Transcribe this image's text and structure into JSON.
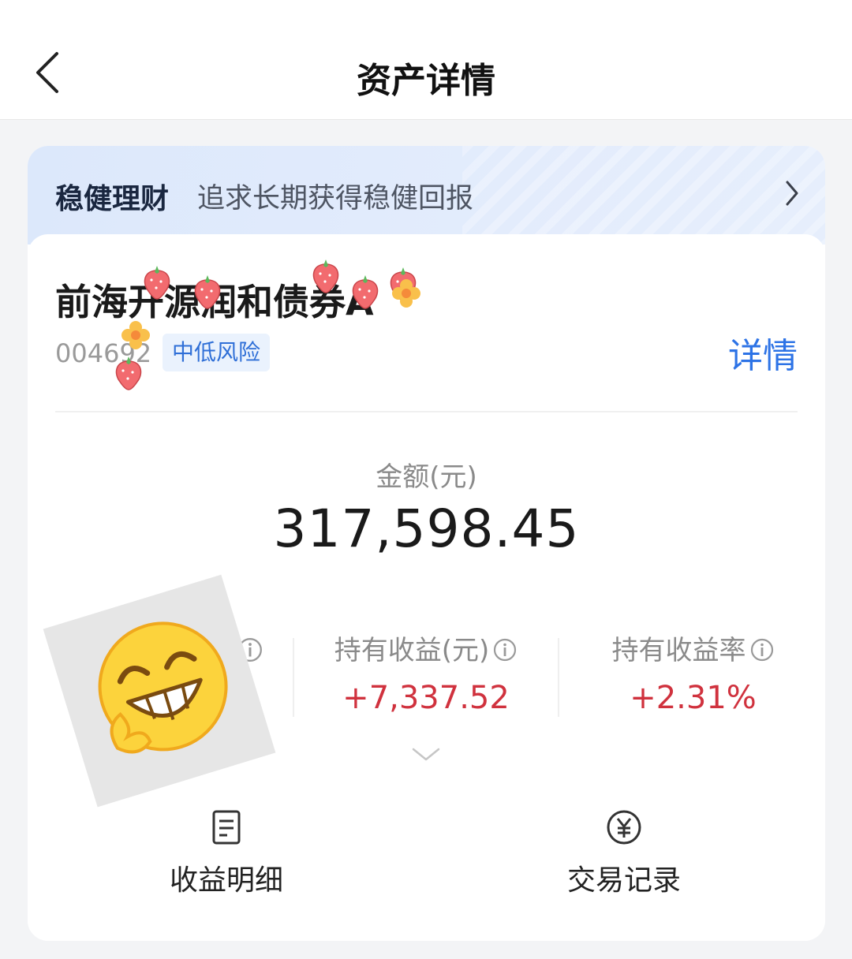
{
  "header": {
    "title": "资产详情",
    "back_icon": "chevron-left-icon"
  },
  "banner": {
    "title": "稳健理财",
    "subtitle": "追求长期获得稳健回报",
    "chevron_icon": "chevron-right-icon"
  },
  "fund": {
    "name": "前海开源润和债券A",
    "code": "004692",
    "risk_level": "中低风险",
    "detail_link": "详情"
  },
  "amount": {
    "label": "金额(元)",
    "value": "317,598.45"
  },
  "stats": [
    {
      "label": "持有收益(元)",
      "value": "+7,337.52"
    },
    {
      "label": "持有收益率",
      "value": "+2.31%"
    }
  ],
  "actions": [
    {
      "label": "收益明细",
      "icon": "document-icon"
    },
    {
      "label": "交易记录",
      "icon": "yuan-coin-icon"
    }
  ],
  "colors": {
    "accent_blue": "#2d73e6",
    "gain_red": "#d0323e",
    "banner_bg": "#dce8fb",
    "page_bg": "#f3f4f6"
  }
}
